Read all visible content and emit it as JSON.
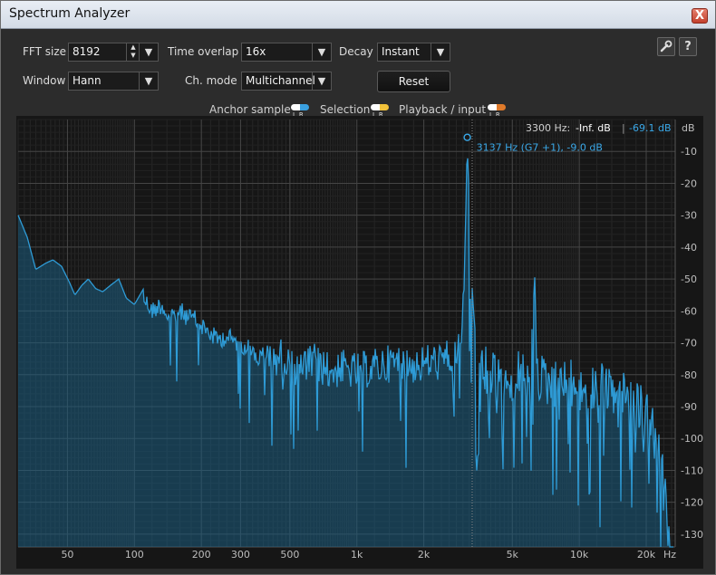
{
  "window": {
    "title": "Spectrum Analyzer",
    "close_label": "X"
  },
  "controls": {
    "fft_size": {
      "label": "FFT size",
      "value": "8192"
    },
    "time_overlap": {
      "label": "Time overlap",
      "value": "16x"
    },
    "decay": {
      "label": "Decay",
      "value": "Instant"
    },
    "window": {
      "label": "Window",
      "value": "Hann"
    },
    "ch_mode": {
      "label": "Ch. mode",
      "value": "Multichannel"
    },
    "reset_label": "Reset",
    "help_label": "?"
  },
  "legend": {
    "anchor": "Anchor sample",
    "selection": "Selection",
    "playback": "Playback / input",
    "lr": "LR",
    "colors": {
      "anchor_r": "#3aa0e0",
      "selection_r": "#f2c23a",
      "playback_r": "#e07a2a"
    }
  },
  "readout": {
    "freq": "3300 Hz:",
    "value1": "-Inf. dB",
    "sep": "|",
    "value2": "-69.1 dB"
  },
  "peak_label": "3137 Hz (G7 +1), -9.0 dB",
  "colors": {
    "spectrum": "#2e9bd6",
    "fill": "#1b5d80",
    "grid": "#3e3e3e",
    "plot_bg": "#161616"
  },
  "chart_data": {
    "type": "line",
    "x_scale": "log",
    "y_unit_label": "dB",
    "x_unit_label": "Hz",
    "xlim": [
      30,
      27000
    ],
    "ylim": [
      -134,
      0
    ],
    "x_ticks": [
      {
        "v": 50,
        "label": "50"
      },
      {
        "v": 100,
        "label": "100"
      },
      {
        "v": 200,
        "label": "200"
      },
      {
        "v": 300,
        "label": "300"
      },
      {
        "v": 500,
        "label": "500"
      },
      {
        "v": 1000,
        "label": "1k"
      },
      {
        "v": 2000,
        "label": "2k"
      },
      {
        "v": 5000,
        "label": "5k"
      },
      {
        "v": 10000,
        "label": "10k"
      },
      {
        "v": 20000,
        "label": "20k"
      }
    ],
    "y_ticks": [
      {
        "v": -10,
        "label": "-10"
      },
      {
        "v": -20,
        "label": "-20"
      },
      {
        "v": -30,
        "label": "-30"
      },
      {
        "v": -40,
        "label": "-40"
      },
      {
        "v": -50,
        "label": "-50"
      },
      {
        "v": -60,
        "label": "-60"
      },
      {
        "v": -70,
        "label": "-70"
      },
      {
        "v": -80,
        "label": "-80"
      },
      {
        "v": -90,
        "label": "-90"
      },
      {
        "v": -100,
        "label": "-100"
      },
      {
        "v": -110,
        "label": "-110"
      },
      {
        "v": -120,
        "label": "-120"
      },
      {
        "v": -130,
        "label": "-130"
      }
    ],
    "peak": {
      "x": 3137,
      "y": -9.0
    },
    "cursor_x": 3300,
    "envelope": [
      [
        30,
        -30
      ],
      [
        33,
        -37
      ],
      [
        36,
        -47
      ],
      [
        40,
        -45
      ],
      [
        43,
        -44
      ],
      [
        47,
        -46
      ],
      [
        51,
        -51
      ],
      [
        54,
        -55
      ],
      [
        58,
        -52
      ],
      [
        62,
        -50
      ],
      [
        67,
        -53
      ],
      [
        72,
        -54
      ],
      [
        78,
        -52
      ],
      [
        85,
        -50
      ],
      [
        92,
        -56
      ],
      [
        100,
        -58
      ],
      [
        110,
        -53
      ],
      [
        120,
        -57
      ],
      [
        132,
        -55
      ],
      [
        145,
        -60
      ],
      [
        160,
        -57
      ],
      [
        175,
        -59
      ],
      [
        190,
        -60
      ],
      [
        210,
        -63
      ],
      [
        235,
        -66
      ],
      [
        260,
        -65
      ],
      [
        290,
        -67
      ],
      [
        320,
        -68
      ],
      [
        360,
        -72
      ],
      [
        400,
        -70
      ],
      [
        450,
        -68
      ],
      [
        500,
        -71
      ],
      [
        570,
        -72
      ],
      [
        650,
        -70
      ],
      [
        750,
        -73
      ],
      [
        850,
        -72
      ],
      [
        1000,
        -73
      ],
      [
        1150,
        -72
      ],
      [
        1300,
        -71
      ],
      [
        1500,
        -70
      ],
      [
        1700,
        -71
      ],
      [
        1900,
        -71
      ],
      [
        2100,
        -70
      ],
      [
        2400,
        -70
      ],
      [
        2700,
        -68
      ],
      [
        2950,
        -64
      ],
      [
        3050,
        -40
      ],
      [
        3100,
        -20
      ],
      [
        3137,
        -9
      ],
      [
        3180,
        -20
      ],
      [
        3250,
        -45
      ],
      [
        3400,
        -66
      ],
      [
        3700,
        -70
      ],
      [
        4000,
        -72
      ],
      [
        4500,
        -72
      ],
      [
        5000,
        -73
      ],
      [
        5500,
        -72
      ],
      [
        6000,
        -70
      ],
      [
        6250,
        -55
      ],
      [
        6300,
        -48
      ],
      [
        6350,
        -60
      ],
      [
        6500,
        -72
      ],
      [
        7000,
        -74
      ],
      [
        8000,
        -75
      ],
      [
        9000,
        -75
      ],
      [
        10000,
        -76
      ],
      [
        11000,
        -76
      ],
      [
        12000,
        -76
      ],
      [
        13500,
        -77
      ],
      [
        15000,
        -77
      ],
      [
        16500,
        -79
      ],
      [
        18000,
        -81
      ],
      [
        19500,
        -84
      ],
      [
        21000,
        -88
      ],
      [
        22500,
        -95
      ],
      [
        23500,
        -103
      ],
      [
        24500,
        -113
      ],
      [
        25500,
        -123
      ],
      [
        26500,
        -134
      ]
    ]
  }
}
